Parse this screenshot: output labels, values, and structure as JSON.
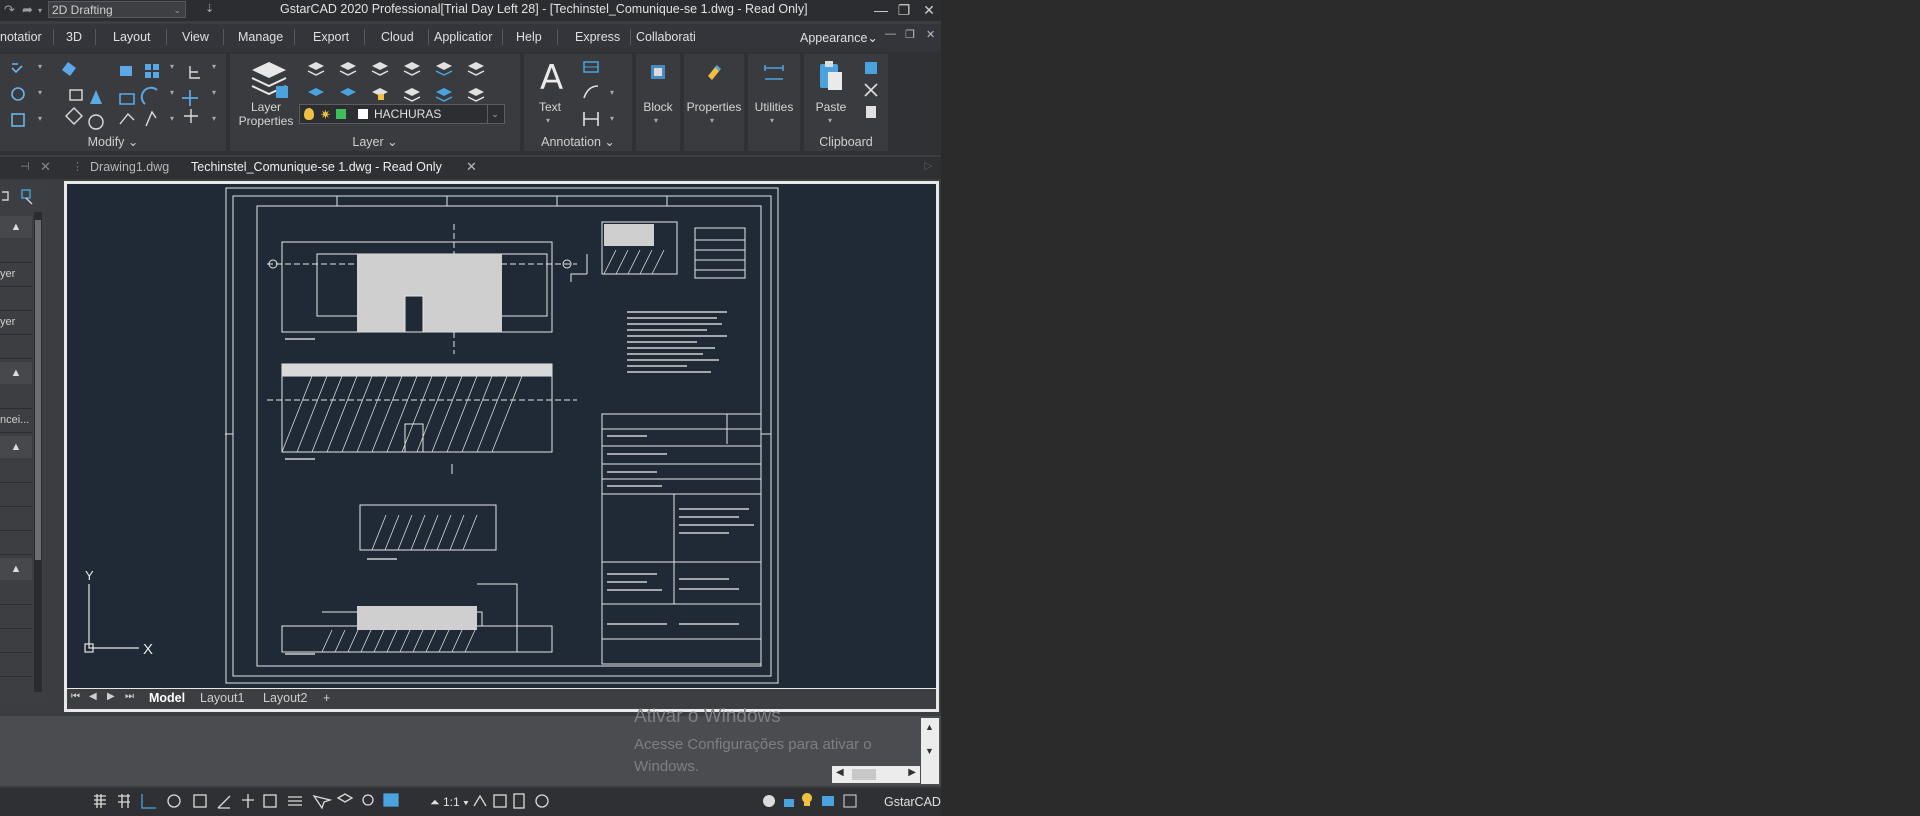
{
  "titlebar": {
    "workspace": "2D Drafting",
    "title": "GstarCAD 2020 Professional[Trial Day Left 28] - [Techinstel_Comunique-se 1.dwg - Read Only]"
  },
  "menu": {
    "tabs": [
      "notatior",
      "3D",
      "Layout",
      "View",
      "Manage",
      "Export",
      "Cloud",
      "Applicatior",
      "Help",
      "Express",
      "Collaborati"
    ],
    "appearance": "Appearance"
  },
  "ribbon": {
    "modify_label": "Modify",
    "layer_properties_label1": "Layer",
    "layer_properties_label2": "Properties",
    "layer_label": "Layer",
    "layer_combo": "HACHURAS",
    "text_label": "Text",
    "annotation_label": "Annotation",
    "block_label": "Block",
    "properties_label": "Properties",
    "utilities_label": "Utilities",
    "paste_label": "Paste",
    "clipboard_label": "Clipboard"
  },
  "doc_tabs": {
    "tab1": "Drawing1.dwg",
    "tab2": "Techinstel_Comunique-se 1.dwg - Read Only"
  },
  "palette": {
    "rows": [
      "yer",
      "yer",
      "ncei..."
    ]
  },
  "layout_tabs": {
    "model": "Model",
    "layout1": "Layout1",
    "layout2": "Layout2",
    "add": "+"
  },
  "activation": {
    "title": "Ativar o Windows",
    "line1": "Acesse Configurações para ativar o",
    "line2": "Windows."
  },
  "statusbar": {
    "scale": "1:1",
    "brand": "GstarCAD"
  },
  "drawing": {
    "ucs_y": "Y",
    "ucs_x": "X"
  },
  "colors": {
    "canvas_bg": "#202a36",
    "ribbon_bg": "#2f3135",
    "accent_blue": "#4aa3df"
  }
}
